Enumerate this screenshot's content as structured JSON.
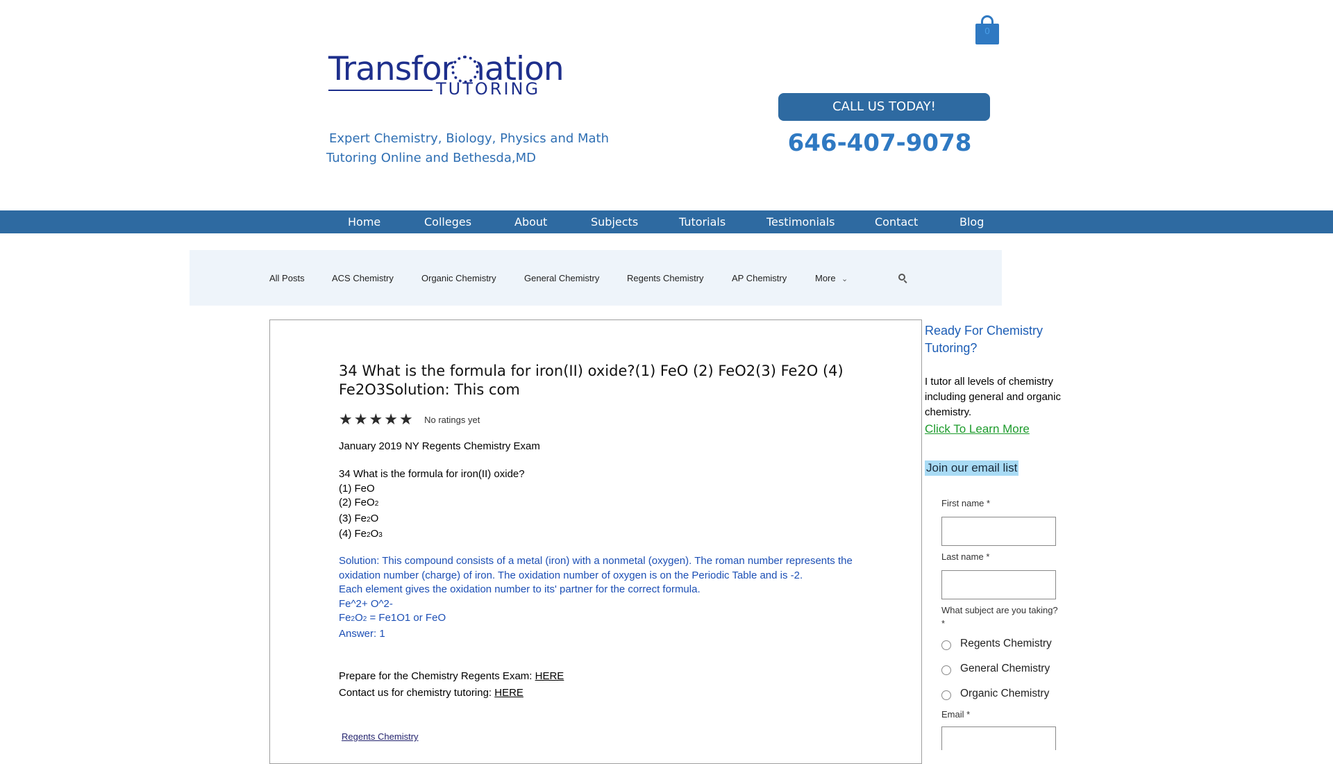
{
  "header": {
    "logo_top": "Transformation",
    "logo_bottom": "TUTORING",
    "tagline_line1": "Expert Chemistry, Biology, Physics and Math",
    "tagline_line2": "Tutoring Online and Bethesda,MD",
    "cart_count": "0",
    "call_button": "CALL US TODAY!",
    "phone": "646-407-9078"
  },
  "main_nav": [
    "Home",
    "Colleges",
    "About",
    "Subjects",
    "Tutorials",
    "Testimonials",
    "Contact",
    "Blog"
  ],
  "category_nav": [
    "All Posts",
    "ACS Chemistry",
    "Organic Chemistry",
    "General Chemistry",
    "Regents Chemistry",
    "AP Chemistry",
    "More"
  ],
  "post": {
    "title": "34 What is the formula for iron(II) oxide?(1) FeO (2) FeO2(3) Fe2O (4) Fe2O3Solution: This com",
    "rating_text": "No ratings yet",
    "exam": "January 2019 NY Regents Chemistry Exam",
    "question": "34 What is the formula for iron(II) oxide?",
    "opt1": "(1) FeO",
    "opt2_a": "(2) FeO",
    "opt2_sub": "2",
    "opt3_a": "(3) Fe",
    "opt3_sub": "2",
    "opt3_b": "O",
    "opt4_a": "(4) Fe",
    "opt4_sub1": "2",
    "opt4_b": "O",
    "opt4_sub2": "3",
    "solution": "Solution: This compound consists of a metal (iron) with a nonmetal (oxygen). The roman number represents the oxidation number (charge) of iron. The oxidation number of oxygen is on the Periodic Table and is -2.",
    "explain": "Each element gives the oxidation number to its' partner for the correct formula.",
    "ions": "Fe^2+ O^2-",
    "formula_a": "Fe",
    "formula_sub1": "2",
    "formula_b": "O",
    "formula_sub2": "2",
    "formula_c": " = Fe1O1 or FeO",
    "answer": "Answer: 1",
    "prepare_text": "Prepare for the Chemistry Regents Exam: ",
    "prepare_link": "HERE",
    "contact_text": "Contact us for chemistry tutoring: ",
    "contact_link": "HERE",
    "tag": "Regents Chemistry"
  },
  "sidebar": {
    "title": "Ready For Chemistry Tutoring?",
    "desc": "I tutor all levels of chemistry including general and organic chemistry.",
    "learn_more": "Click To Learn More",
    "join": "Join our email list",
    "first_name_label": "First name *",
    "last_name_label": "Last name *",
    "subject_label": "What subject are you taking? *",
    "subjects": [
      "Regents Chemistry",
      "General Chemistry",
      "Organic Chemistry"
    ],
    "email_label": "Email *"
  },
  "colors": {
    "brand_blue": "#2e6aa1",
    "phone_blue": "#2f79c2",
    "solution_blue": "#1c4fb5",
    "learn_green": "#1d9b2c",
    "category_bg": "#eef4fa"
  }
}
